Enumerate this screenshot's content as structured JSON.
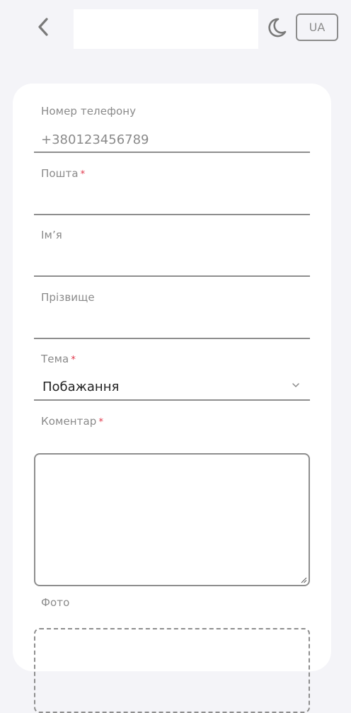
{
  "header": {
    "back_icon": "chevron-left-icon",
    "theme_icon": "moon-icon",
    "language": "UA"
  },
  "form": {
    "phone": {
      "label": "Номер телефону",
      "value": "+380123456789"
    },
    "email": {
      "label": "Пошта",
      "required_mark": "*",
      "value": ""
    },
    "first_name": {
      "label": "Ім’я",
      "value": ""
    },
    "last_name": {
      "label": "Прізвище",
      "value": ""
    },
    "topic": {
      "label": "Тема",
      "required_mark": "*",
      "selected": "Побажання"
    },
    "comment": {
      "label": "Коментар",
      "required_mark": "*",
      "value": ""
    },
    "photo": {
      "label": "Фото"
    }
  },
  "colors": {
    "background": "#f4f4f8",
    "card": "#ffffff",
    "required": "#e0364a",
    "border": "#8e8e8e",
    "muted_text": "#8a8a8a"
  }
}
